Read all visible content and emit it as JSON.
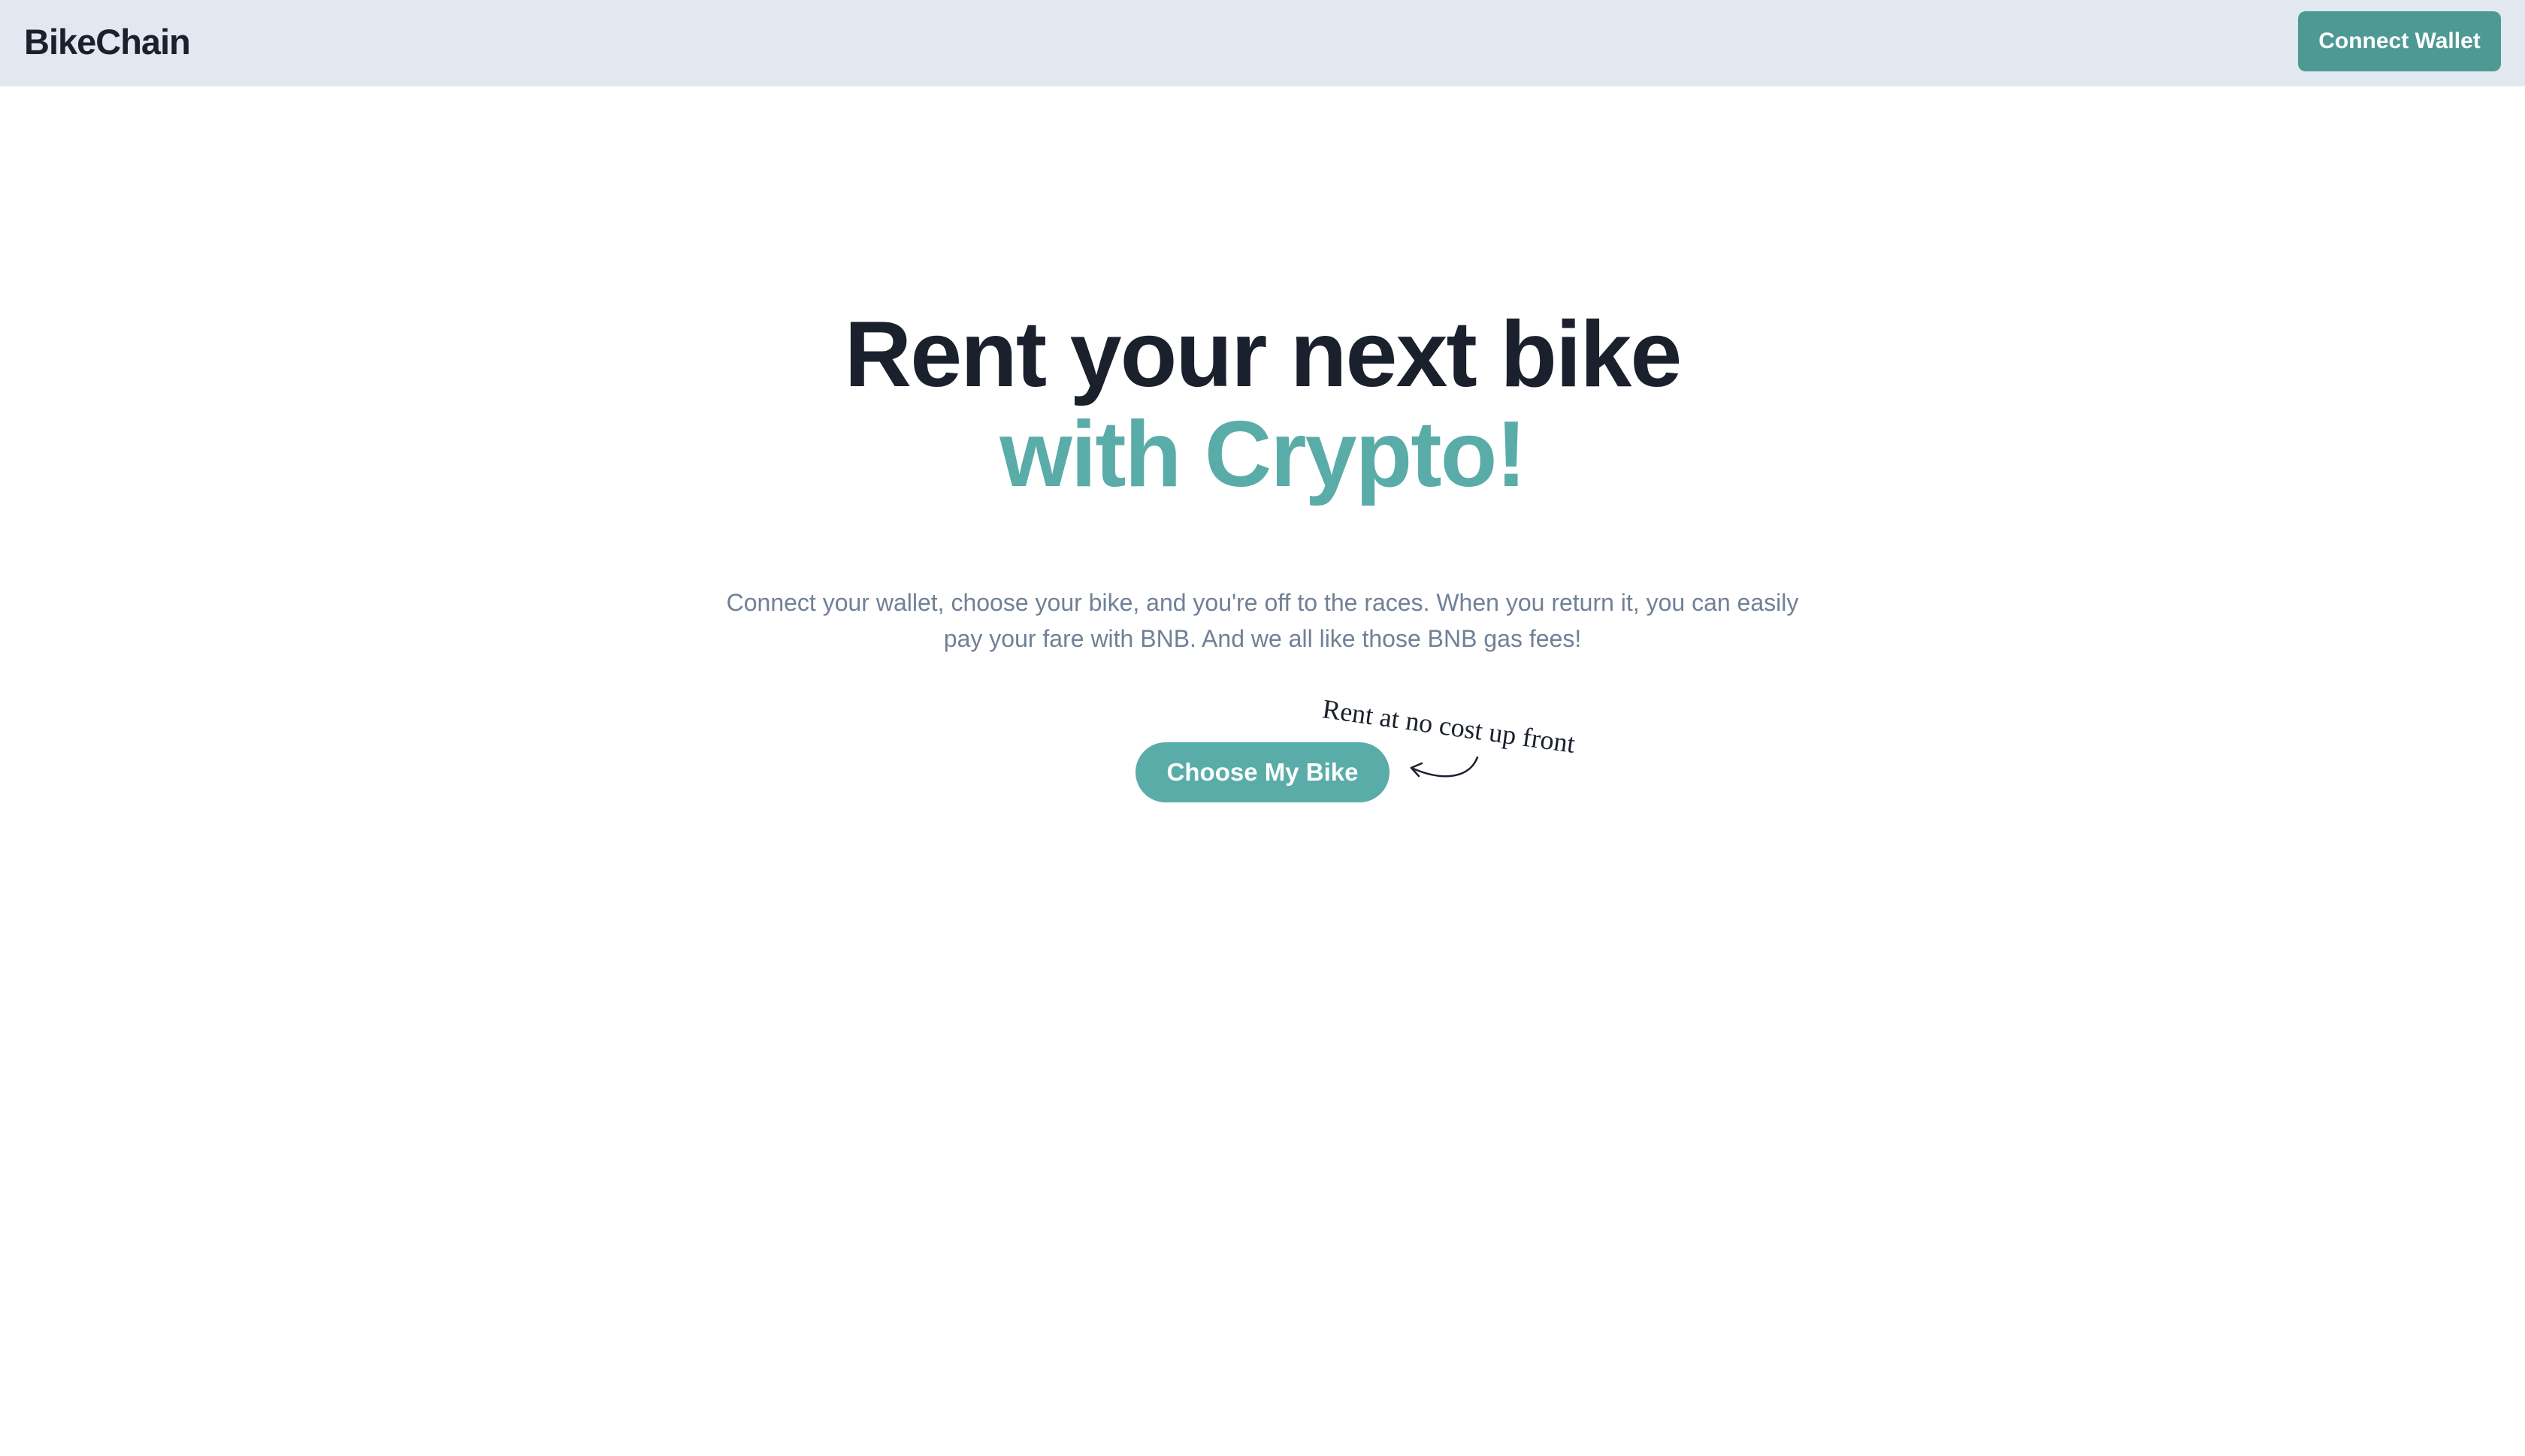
{
  "header": {
    "brand": "BikeChain",
    "connect_label": "Connect Wallet"
  },
  "hero": {
    "headline_line1": "Rent your next bike",
    "headline_line2": "with Crypto!",
    "description": "Connect your wallet, choose your bike, and you're off to the races. When you return it, you can easily pay your fare with BNB. And we all like those BNB gas fees!",
    "cta_label": "Choose My Bike",
    "annotation": "Rent at no cost up front"
  },
  "colors": {
    "accent": "#5aaca8",
    "button_dark": "#4e9994",
    "nav_bg": "#e2e8f0",
    "text_dark": "#1a202c",
    "text_muted": "#718096"
  },
  "icons": {
    "annotation_arrow": "curved-arrow-icon"
  }
}
